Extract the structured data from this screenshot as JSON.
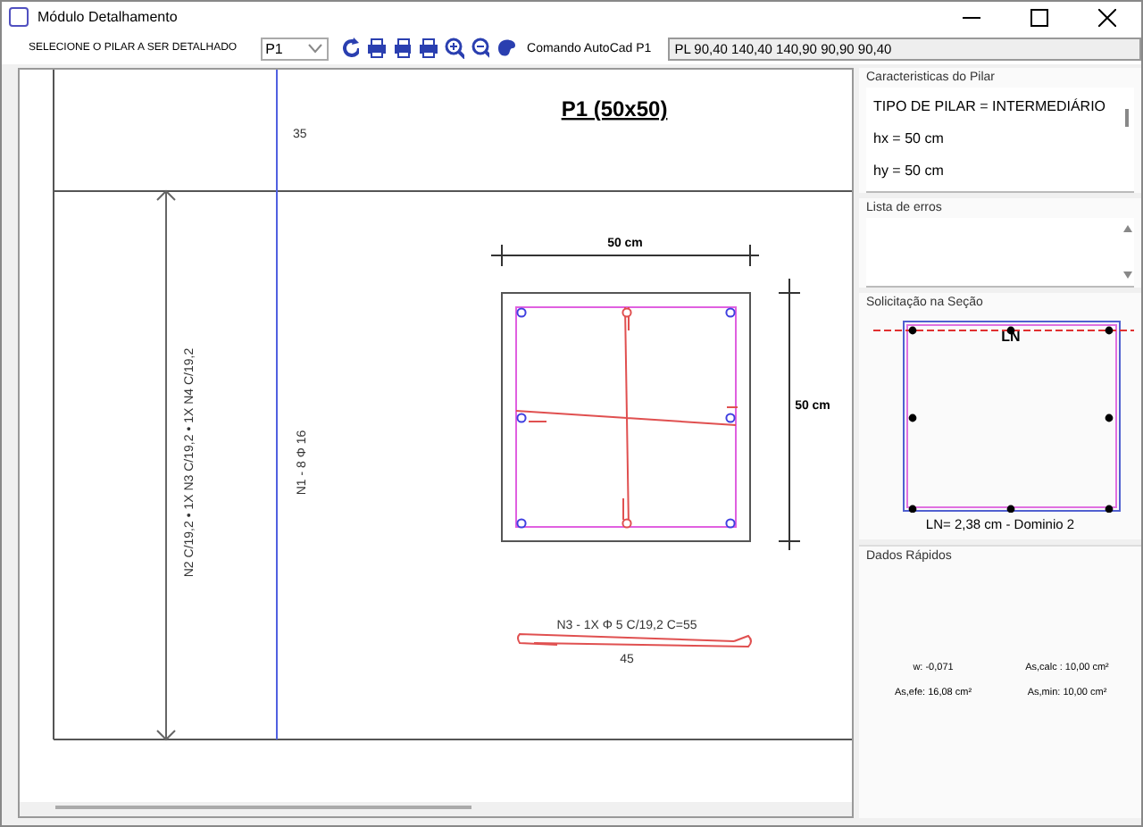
{
  "window": {
    "title": "Módulo Detalhamento"
  },
  "toolbar": {
    "pillar_label": "SELECIONE O PILAR A SER DETALHADO",
    "pillar_value": "P1",
    "command_label": "Comando AutoCad P1",
    "command_value": "PL 90,40 140,40 140,90 90,90 90,40"
  },
  "drawing": {
    "title": "P1 (50x50)",
    "top_length": "35",
    "longitudinal_label": "N1 - 8 Φ 16",
    "stirrup_run_label": "N2 C/19,2 • 1X N3 C/19,2 • 1X N4 C/19,2",
    "width_dim": "50 cm",
    "height_dim": "50 cm",
    "stirrup_label": "N3 - 1X  Φ 5 C/19,2 C=55",
    "stirrup_length": "45"
  },
  "characteristics": {
    "title": "Caracteristicas do Pilar",
    "lines": [
      "TIPO DE PILAR = INTERMEDIÁRIO",
      "hx = 50 cm",
      "hy = 50 cm"
    ]
  },
  "errors": {
    "title": "Lista de erros"
  },
  "section": {
    "title": "Solicitação na Seção",
    "neutral_axis_label": "LN",
    "caption": "LN= 2,38 cm - Dominio 2"
  },
  "quick_data": {
    "title": "Dados Rápidos",
    "items": [
      "w: -0,071",
      "As,calc : 10,00 cm²",
      "As,efe: 16,08 cm²",
      "As,min: 10,00 cm²"
    ]
  }
}
